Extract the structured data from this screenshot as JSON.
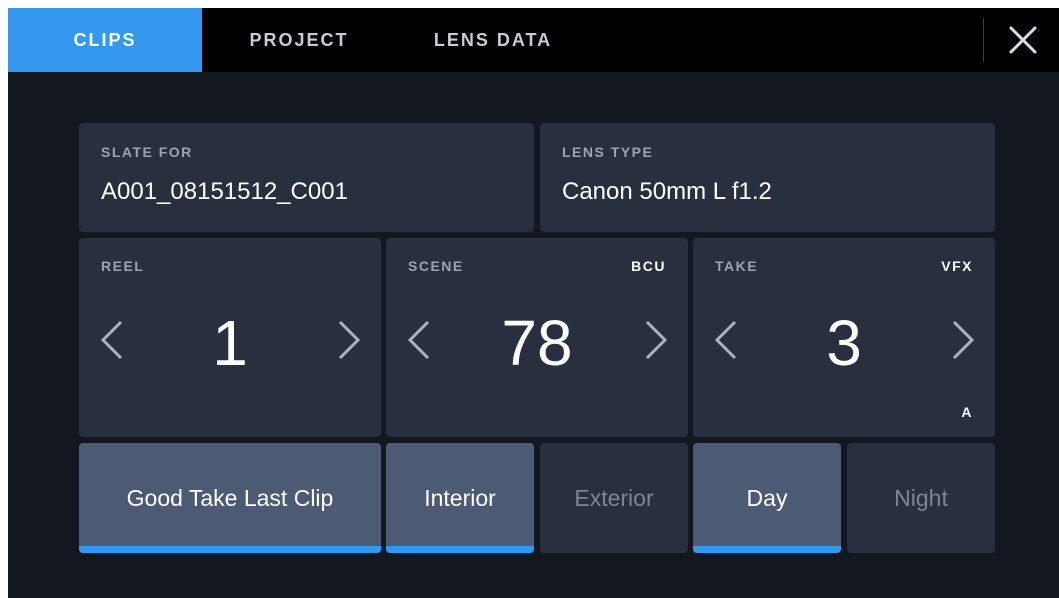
{
  "tabs": {
    "clips": "CLIPS",
    "project": "PROJECT",
    "lens_data": "LENS DATA"
  },
  "close_icon": "close-x-icon",
  "slate_for": {
    "label": "SLATE FOR",
    "value": "A001_08151512_C001"
  },
  "lens_type": {
    "label": "LENS TYPE",
    "value": "Canon 50mm L f1.2"
  },
  "reel": {
    "label": "REEL",
    "value": "1"
  },
  "scene": {
    "label": "SCENE",
    "tag": "BCU",
    "value": "78"
  },
  "take": {
    "label": "TAKE",
    "tag": "VFX",
    "value": "3",
    "suffix": "A"
  },
  "toggles": {
    "good_take": "Good Take Last Clip",
    "interior": "Interior",
    "exterior": "Exterior",
    "day": "Day",
    "night": "Night"
  },
  "colors": {
    "accent": "#3398ee",
    "panel": "#28303f",
    "toggle_on": "#4c5a74",
    "background": "#131720"
  }
}
